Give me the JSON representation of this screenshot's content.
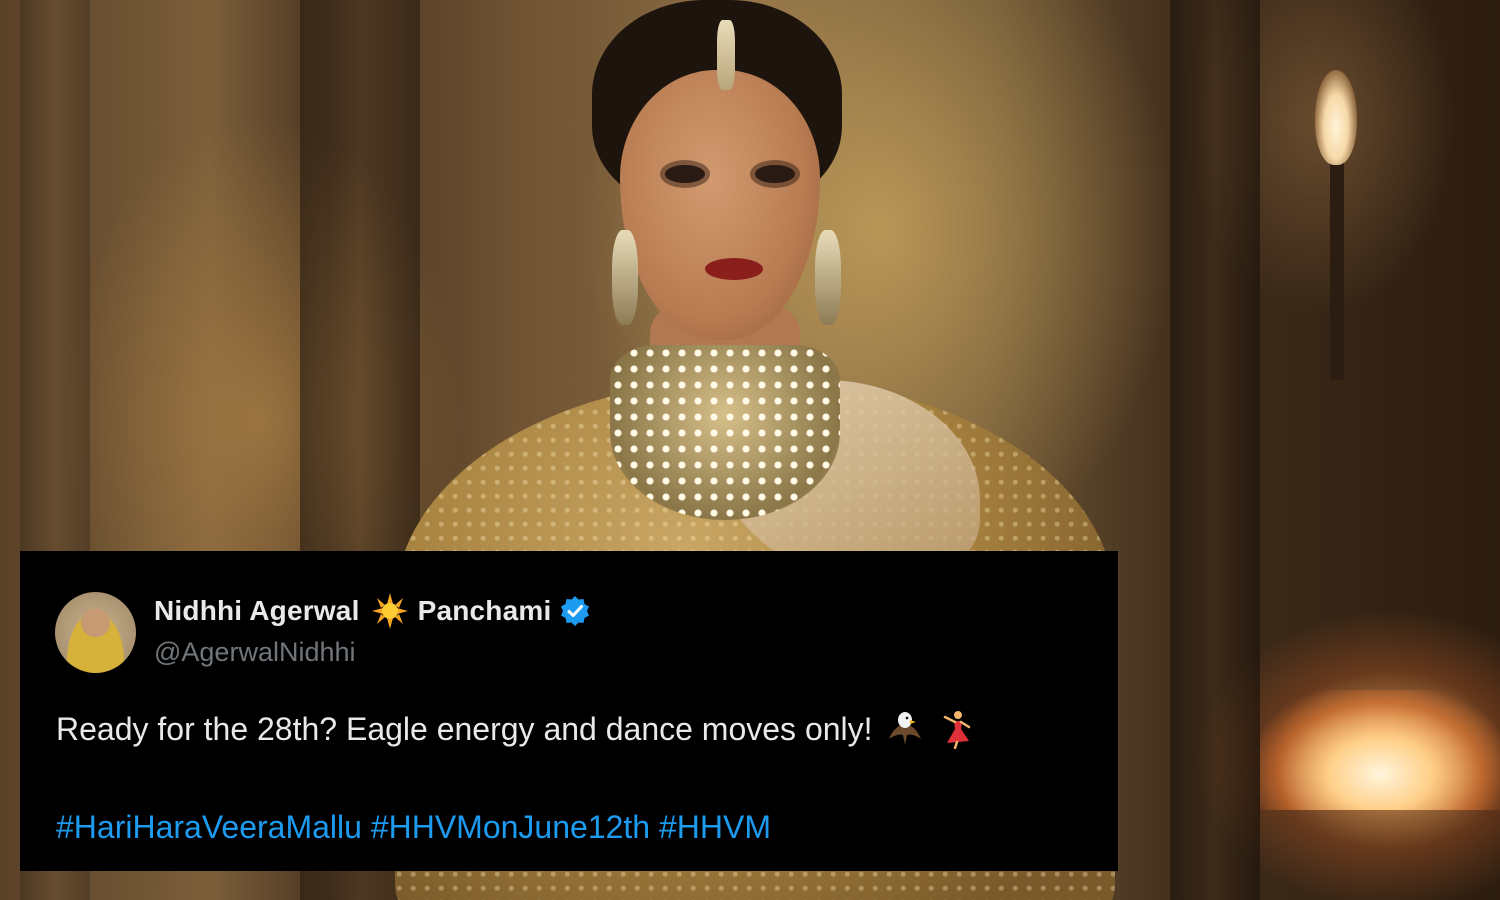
{
  "tweet": {
    "display_name_part1": "Nidhhi Agerwal",
    "display_name_part2": "Panchami",
    "handle": "@AgerwalNidhhi",
    "text": "Ready for the 28th? Eagle energy and dance moves only!",
    "emojis": [
      "eagle-icon",
      "dancer-icon"
    ],
    "hashtags": [
      "#HariHaraVeeraMallu",
      "#HHVMonJune12th",
      "#HHVM"
    ],
    "verified": true
  },
  "colors": {
    "card_background": "#000000",
    "name_text": "#e7e9ea",
    "handle_text": "#71767b",
    "hashtag": "#1d9bf0",
    "verified_badge": "#1d9bf0"
  }
}
